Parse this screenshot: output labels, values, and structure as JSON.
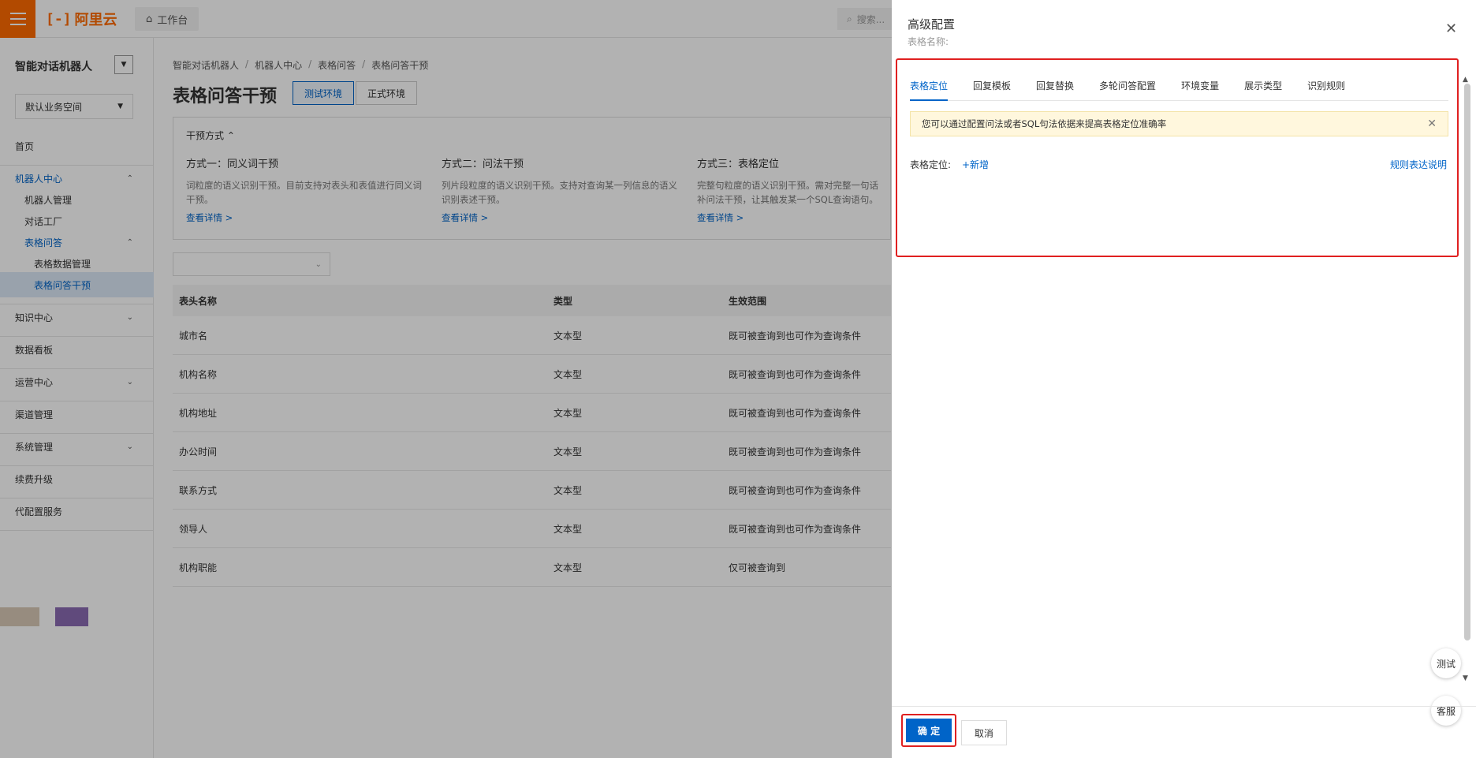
{
  "topbar": {
    "brand": "阿里云",
    "workbench": "工作台",
    "search_placeholder": "搜索..."
  },
  "sidebar": {
    "title": "智能对话机器人",
    "workspace": "默认业务空间",
    "items": {
      "home": "首页",
      "robot_center": "机器人中心",
      "robot_mgmt": "机器人管理",
      "dialog_factory": "对话工厂",
      "table_qa": "表格问答",
      "table_data_mgmt": "表格数据管理",
      "table_qa_intervene": "表格问答干预",
      "knowledge": "知识中心",
      "dashboard": "数据看板",
      "operation": "运营中心",
      "channel": "渠道管理",
      "system": "系统管理",
      "renew": "续费升级",
      "proxy": "代配置服务"
    }
  },
  "main": {
    "breadcrumb": [
      "智能对话机器人",
      "机器人中心",
      "表格问答",
      "表格问答干预"
    ],
    "title": "表格问答干预",
    "env_test": "测试环境",
    "env_prod": "正式环境",
    "card": {
      "head": "干预方式",
      "methods": [
        {
          "title": "方式一：同义词干预",
          "desc": "词粒度的语义识别干预。目前支持对表头和表值进行同义词干预。",
          "link": "查看详情 >"
        },
        {
          "title": "方式二：问法干预",
          "desc": "列片段粒度的语义识别干预。支持对查询某一列信息的语义识别表述干预。",
          "link": "查看详情 >"
        },
        {
          "title": "方式三：表格定位",
          "desc": "完整句粒度的语义识别干预。需对完整一句话补问法干预，让其触发某一个SQL查询语句。",
          "link": "查看详情 >"
        }
      ]
    },
    "table": {
      "headers": [
        "表头名称",
        "类型",
        "生效范围"
      ],
      "rows": [
        [
          "城市名",
          "文本型",
          "既可被查询到也可作为查询条件"
        ],
        [
          "机构名称",
          "文本型",
          "既可被查询到也可作为查询条件"
        ],
        [
          "机构地址",
          "文本型",
          "既可被查询到也可作为查询条件"
        ],
        [
          "办公时间",
          "文本型",
          "既可被查询到也可作为查询条件"
        ],
        [
          "联系方式",
          "文本型",
          "既可被查询到也可作为查询条件"
        ],
        [
          "领导人",
          "文本型",
          "既可被查询到也可作为查询条件"
        ],
        [
          "机构职能",
          "文本型",
          "仅可被查询到"
        ]
      ]
    }
  },
  "drawer": {
    "title": "高级配置",
    "subtitle": "表格名称:",
    "tabs": [
      "表格定位",
      "回复模板",
      "回复替换",
      "多轮问答配置",
      "环境变量",
      "展示类型",
      "识别规则"
    ],
    "notice": "您可以通过配置问法或者SQL句法依据来提高表格定位准确率",
    "locate_label": "表格定位:",
    "add_label": "+新增",
    "rule_link": "规则表达说明",
    "ok": "确 定",
    "cancel": "取消",
    "float_test": "测试",
    "float_service": "客服"
  },
  "colors": {
    "brand": "#ff6a00",
    "primary": "#0064c8",
    "highlight": "#e02020"
  }
}
